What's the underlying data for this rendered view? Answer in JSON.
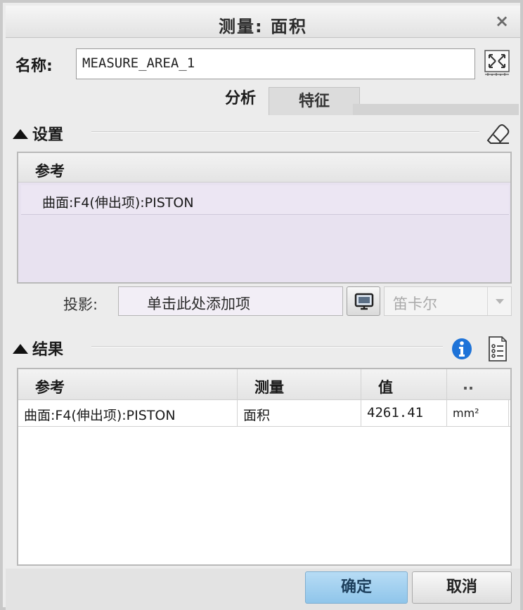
{
  "window": {
    "title": "测量: 面积",
    "close": "×"
  },
  "name_row": {
    "label": "名称:",
    "value": "MEASURE_AREA_1"
  },
  "tabs": [
    {
      "label": "分析",
      "active": true
    },
    {
      "label": "特征",
      "active": false
    }
  ],
  "settings": {
    "header": "设置",
    "reference_header": "参考",
    "references": [
      "曲面:F4(伸出项):PISTON"
    ],
    "projection_label": "投影:",
    "projection_placeholder": "单击此处添加项",
    "coordinate_system": "笛卡尔"
  },
  "results": {
    "header": "结果",
    "columns": [
      "参考",
      "测量",
      "值",
      ".."
    ],
    "rows": [
      {
        "reference": "曲面:F4(伸出项):PISTON",
        "measure": "面积",
        "value": "4261.41",
        "unit": "mm²"
      }
    ]
  },
  "buttons": {
    "ok": "确定",
    "cancel": "取消"
  },
  "colors": {
    "ok_button": "#9fd0f0",
    "selection": "#e8e2f0",
    "info_icon": "#1e73d8"
  }
}
